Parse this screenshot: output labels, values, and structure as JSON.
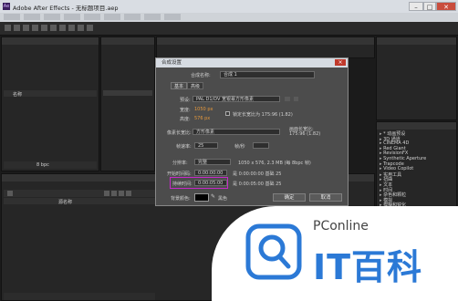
{
  "window": {
    "title": "Adobe After Effects - 无标题项目.aep",
    "minimize_glyph": "–",
    "maximize_glyph": "□",
    "close_glyph": "✕"
  },
  "project_panel": {
    "col_name": "名称",
    "bpc": "8 bpc"
  },
  "timeline": {
    "col_layer_name": "源名称",
    "status_text": "切换开关/模式"
  },
  "dialog": {
    "title": "合成设置",
    "comp_name_label": "合成名称:",
    "comp_name_value": "合成 1",
    "tabs": [
      "基本",
      "高级"
    ],
    "preset_label": "预设:",
    "preset_value": "PAL D1/DV 宽银幕方形像素",
    "width_label": "宽度:",
    "width_value": "1050 px",
    "height_label": "高度:",
    "height_value": "576 px",
    "lock_aspect_label": "锁定长宽比为 175:96 (1.82)",
    "pixel_aspect_label": "像素长宽比:",
    "pixel_aspect_value": "方形像素",
    "frame_aspect_label": "画面长宽比:",
    "frame_aspect_value": "175:96 (1.82)",
    "frame_rate_label": "帧速率:",
    "frame_rate_value": "25",
    "frame_rate_unit": "帧/秒",
    "resolution_label": "分辨率:",
    "resolution_value": "完整",
    "resolution_info": "1050 x 576, 2.3 MB (每 8bpc 帧)",
    "start_timecode_label": "开始时间码:",
    "start_timecode_value": "0:00:00:00",
    "start_timecode_note": "是 0:00:00:00 基础 25",
    "duration_label": "持续时间:",
    "duration_value": "0:00:05:00",
    "duration_note": "是 0:00:05:00 基础 25",
    "bg_color_label": "背景颜色:",
    "bg_color_name": "黑色",
    "ok_label": "确定",
    "cancel_label": "取消",
    "preview_label": "预览"
  },
  "effects_panel": {
    "items": [
      "* 动画预设",
      "3D 通道",
      "CINEMA 4D",
      "Red Giant",
      "RevisionFX",
      "Synthetic Aperture",
      "Trapcode",
      "Video Copilot",
      "实用工具",
      "扭曲",
      "文本",
      "时间",
      "杂色和颗粒",
      "模拟",
      "模糊和锐化",
      "生成",
      "表达式控制",
      "过时",
      "过渡",
      "透视"
    ]
  },
  "watermark": {
    "brand_small": "PConline",
    "brand_large": "IT百科"
  },
  "colors": {
    "accent_orange": "#e5983c",
    "highlight_magenta": "#c628c8",
    "watermark_blue": "#2b79d6"
  }
}
